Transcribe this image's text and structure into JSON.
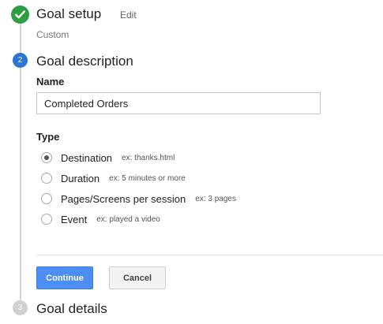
{
  "steps": [
    {
      "status": "complete",
      "icon": "check-icon",
      "title": "Goal setup",
      "edit_label": "Edit",
      "summary": "Custom"
    },
    {
      "status": "active",
      "number": "2",
      "title": "Goal description",
      "name_label": "Name",
      "name_value": "Completed Orders",
      "type_label": "Type",
      "type_options": [
        {
          "label": "Destination",
          "example": "ex: thanks.html",
          "selected": true
        },
        {
          "label": "Duration",
          "example": "ex: 5 minutes or more",
          "selected": false
        },
        {
          "label": "Pages/Screens per session",
          "example": "ex: 3 pages",
          "selected": false
        },
        {
          "label": "Event",
          "example": "ex: played a video",
          "selected": false
        }
      ],
      "continue_label": "Continue",
      "cancel_label": "Cancel"
    },
    {
      "status": "inactive",
      "number": "3",
      "title": "Goal details"
    }
  ],
  "colors": {
    "complete": "#2e9e43",
    "active": "#2b73d6",
    "inactive": "#d0d0d0",
    "primary_button": "#4c8ef5"
  }
}
